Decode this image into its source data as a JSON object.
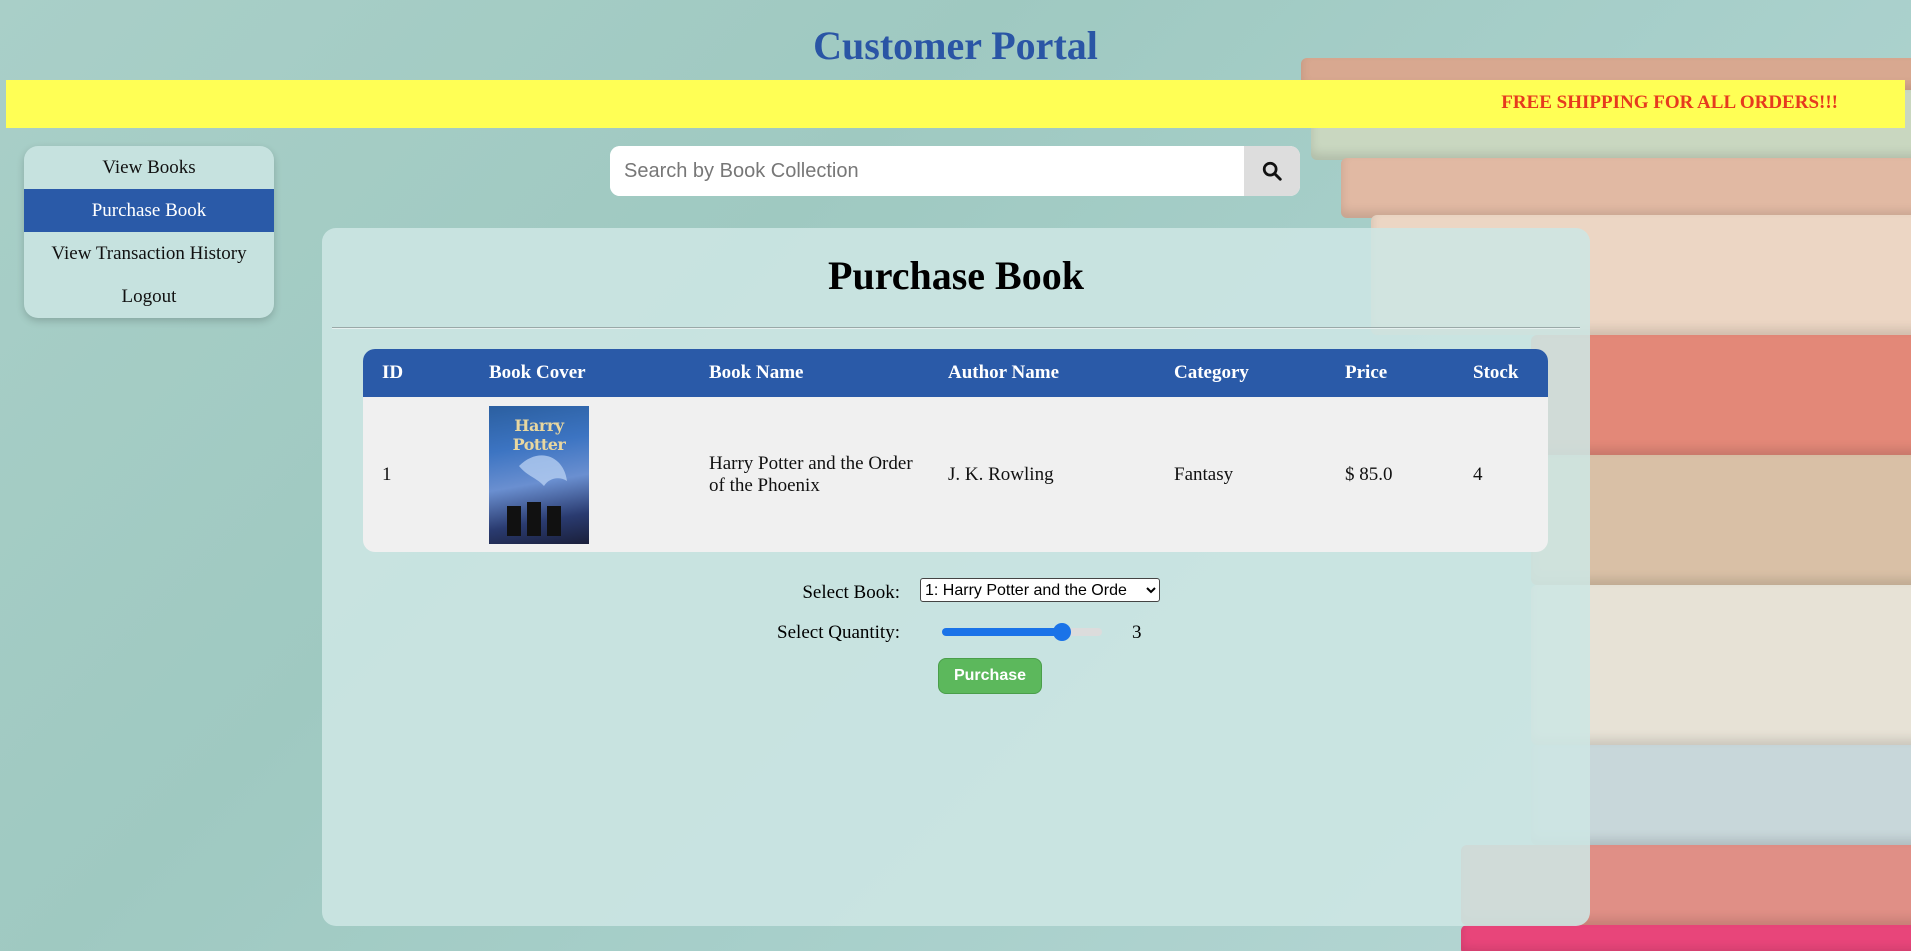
{
  "header": {
    "title": "Customer Portal",
    "banner": "FREE SHIPPING FOR ALL ORDERS!!!"
  },
  "sidebar": {
    "items": [
      {
        "label": "View Books",
        "active": false
      },
      {
        "label": "Purchase Book",
        "active": true
      },
      {
        "label": "View Transaction History",
        "active": false
      },
      {
        "label": "Logout",
        "active": false
      }
    ]
  },
  "search": {
    "placeholder": "Search by Book Collection",
    "icon": "search-icon"
  },
  "main": {
    "title": "Purchase Book",
    "table": {
      "columns": [
        "ID",
        "Book Cover",
        "Book Name",
        "Author Name",
        "Category",
        "Price",
        "Stock"
      ],
      "rows": [
        {
          "id": "1",
          "cover_text": "Harry Potter",
          "name": "Harry Potter and the Order of the Phoenix",
          "author": "J. K. Rowling",
          "category": "Fantasy",
          "price": "$ 85.0",
          "stock": "4"
        }
      ]
    },
    "form": {
      "select_label": "Select Book:",
      "select_value": "1: Harry Potter and the Orde",
      "quantity_label": "Select Quantity:",
      "quantity_value": "3",
      "quantity_max": 4,
      "purchase_label": "Purchase"
    }
  },
  "colors": {
    "brand_blue": "#2a5aa8",
    "banner_yellow": "#ffff55",
    "banner_text": "#e63a1e",
    "button_green": "#5cb85c"
  }
}
